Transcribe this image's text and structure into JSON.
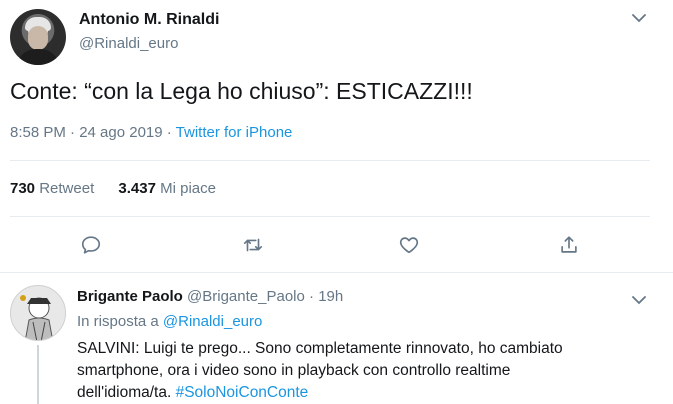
{
  "tweet": {
    "author_name": "Antonio M. Rinaldi",
    "author_handle": "@Rinaldi_euro",
    "text": "Conte: “con la Lega ho chiuso”: ESTICAZZI!!!",
    "time": "8:58 PM · 24 ago 2019 · ",
    "source": "Twitter for iPhone",
    "retweets_count": "730",
    "retweets_label": "Retweet",
    "likes_count": "3.437",
    "likes_label": "Mi piace"
  },
  "actions": {
    "icons": [
      "comment-icon",
      "retweet-icon",
      "heart-icon",
      "share-icon"
    ]
  },
  "reply": {
    "author_name": "Brigante Paolo",
    "author_handle": "@Brigante_Paolo",
    "separator": "·",
    "time": "19h",
    "in_reply_label": "In risposta a ",
    "in_reply_handle": "@Rinaldi_euro",
    "text_line1": "SALVINI: Luigi te prego... Sono completamente rinnovato, ho cambiato",
    "text_line2": "smartphone, ora i video sono in playback con controllo realtime",
    "text_line3": "dell'idioma/ta. ",
    "hashtag": "#SoloNoiConConte"
  },
  "colors": {
    "link": "#1b95e0",
    "muted": "#657786",
    "text": "#14171a",
    "divider": "#e6ecf0"
  }
}
